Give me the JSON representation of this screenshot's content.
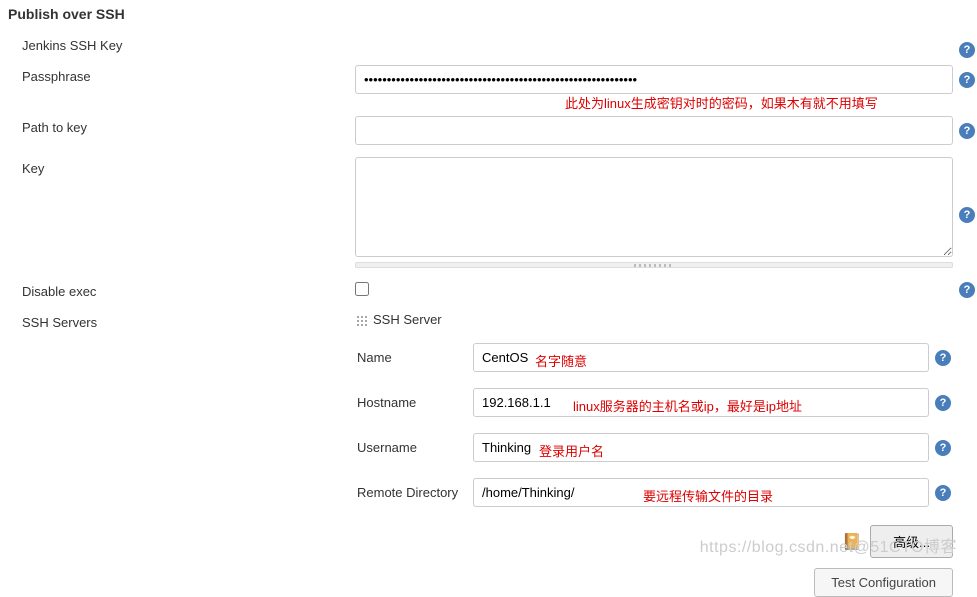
{
  "section_title": "Publish over SSH",
  "rows": {
    "jenkins_ssh_key": {
      "label": "Jenkins SSH Key"
    },
    "passphrase": {
      "label": "Passphrase",
      "value": "••••••••••••••••••••••••••••••••••••••••••••••••••••••••••••"
    },
    "path_to_key": {
      "label": "Path to key",
      "value": ""
    },
    "key": {
      "label": "Key",
      "value": ""
    },
    "disable_exec": {
      "label": "Disable exec",
      "checked": false
    },
    "ssh_servers": {
      "label": "SSH Servers",
      "server_heading": "SSH Server"
    }
  },
  "server": {
    "name": {
      "label": "Name",
      "value": "CentOS"
    },
    "hostname": {
      "label": "Hostname",
      "value": "192.168.1.1"
    },
    "username": {
      "label": "Username",
      "value": "Thinking"
    },
    "remote_dir": {
      "label": "Remote Directory",
      "value": "/home/Thinking/"
    }
  },
  "annotations": {
    "passphrase": "此处为linux生成密钥对时的密码，如果木有就不用填写",
    "name": "名字随意",
    "hostname": "linux服务器的主机名或ip，最好是ip地址",
    "username": "登录用户名",
    "remote_dir": "要远程传输文件的目录"
  },
  "buttons": {
    "advanced": "高级...",
    "test_config": "Test Configuration"
  },
  "watermark": "https://blog.csdn.net@51CTO博客"
}
